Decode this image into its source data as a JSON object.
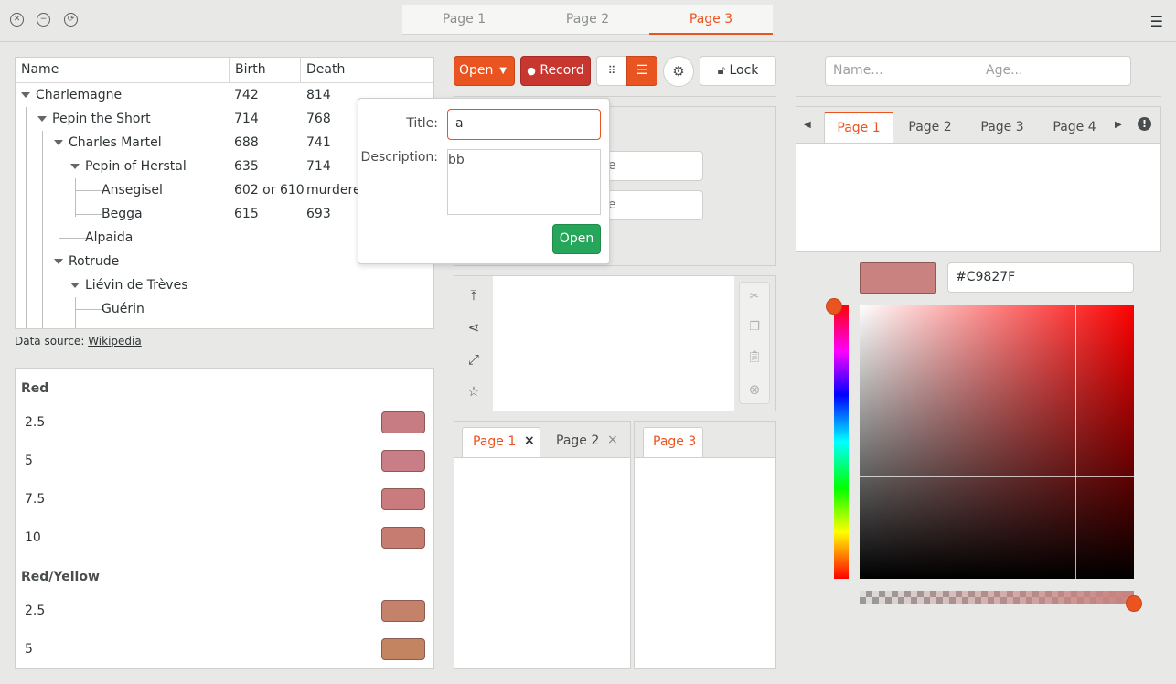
{
  "titlebar": {
    "close_glyph": "✕",
    "minimize_glyph": "−",
    "restore_glyph": "⟳",
    "tabs": [
      {
        "label": "Page 1"
      },
      {
        "label": "Page 2"
      },
      {
        "label": "Page 3"
      }
    ],
    "menu_glyph": "☰"
  },
  "tree": {
    "headers": [
      "Name",
      "Birth",
      "Death"
    ],
    "rows": [
      {
        "name": "Charlemagne",
        "birth": "742",
        "death": "814"
      },
      {
        "name": "Pepin the Short",
        "birth": "714",
        "death": "768"
      },
      {
        "name": "Charles Martel",
        "birth": "688",
        "death": "741"
      },
      {
        "name": "Pepin of Herstal",
        "birth": "635",
        "death": "714"
      },
      {
        "name": "Ansegisel",
        "birth": "602 or 610",
        "death": "murdered"
      },
      {
        "name": "Begga",
        "birth": "615",
        "death": "693"
      },
      {
        "name": "Alpaida",
        "birth": "",
        "death": ""
      },
      {
        "name": "Rotrude",
        "birth": "",
        "death": ""
      },
      {
        "name": "Liévin de Trèves",
        "birth": "",
        "death": ""
      },
      {
        "name": "Guérin",
        "birth": "",
        "death": ""
      }
    ],
    "source_label": "Data source:",
    "source_link": "Wikipedia"
  },
  "swatches": {
    "sections": [
      {
        "title": "Red",
        "items": [
          {
            "label": "2.5",
            "color": "#C77C84"
          },
          {
            "label": "5",
            "color": "#C97D86"
          },
          {
            "label": "7.5",
            "color": "#C97B7E"
          },
          {
            "label": "10",
            "color": "#C67C70"
          }
        ]
      },
      {
        "title": "Red/Yellow",
        "items": [
          {
            "label": "2.5",
            "color": "#C4826A"
          },
          {
            "label": "5",
            "color": "#C38561"
          }
        ]
      }
    ]
  },
  "toolbar": {
    "open_label": "Open",
    "record_label": "Record",
    "lock_label": "Lock"
  },
  "popover": {
    "title_label": "Title:",
    "title_value": "a",
    "description_label": "Description:",
    "description_value": "bb",
    "open_button": "Open"
  },
  "behind": {
    "entry1_tail": "ne",
    "entry2_tail": "ne"
  },
  "notebook_bottom": {
    "tabs_left": [
      {
        "label": "Page 1"
      },
      {
        "label": "Page 2"
      }
    ],
    "tabs_right": [
      {
        "label": "Page 3"
      }
    ],
    "close_glyph": "×"
  },
  "form": {
    "name_placeholder": "Name...",
    "age_placeholder": "Age..."
  },
  "notebook_right": {
    "tabs": [
      {
        "label": "Page 1"
      },
      {
        "label": "Page 2"
      },
      {
        "label": "Page 3"
      },
      {
        "label": "Page 4"
      }
    ]
  },
  "color_picker": {
    "hex_value": "#C9827F",
    "current_color": "#C9827F"
  }
}
